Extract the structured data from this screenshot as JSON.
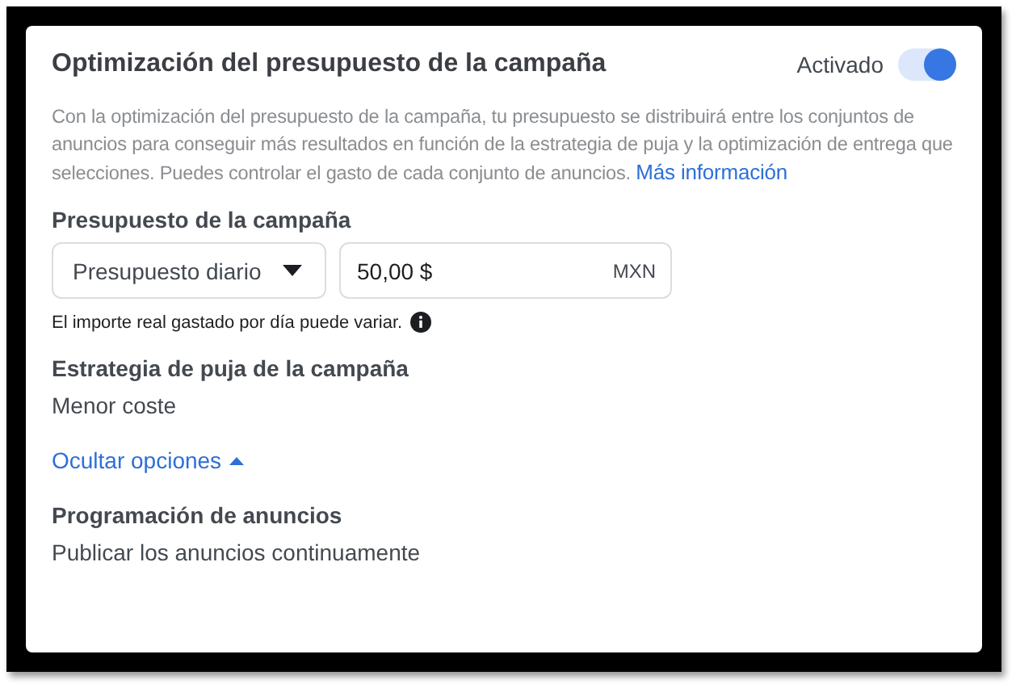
{
  "header": {
    "title": "Optimización del presupuesto de la campaña",
    "toggle_label": "Activado",
    "toggle_on": true
  },
  "description": {
    "text": "Con la optimización del presupuesto de la campaña, tu presupuesto se distribuirá entre los conjuntos de anuncios para conseguir más resultados en función de la estrategia de puja y la optimización de entrega que selecciones. Puedes controlar el gasto de cada conjunto de anuncios.",
    "link": "Más información"
  },
  "budget": {
    "label": "Presupuesto de la campaña",
    "type_dropdown": "Presupuesto diario",
    "amount": "50,00 $",
    "currency": "MXN",
    "note": "El importe real gastado por día puede variar."
  },
  "bid_strategy": {
    "label": "Estrategia de puja de la campaña",
    "value": "Menor coste"
  },
  "options_link": {
    "label": "Ocultar opciones",
    "expanded": true
  },
  "schedule": {
    "label": "Programación de anuncios",
    "value": "Publicar los anuncios continuamente"
  }
}
